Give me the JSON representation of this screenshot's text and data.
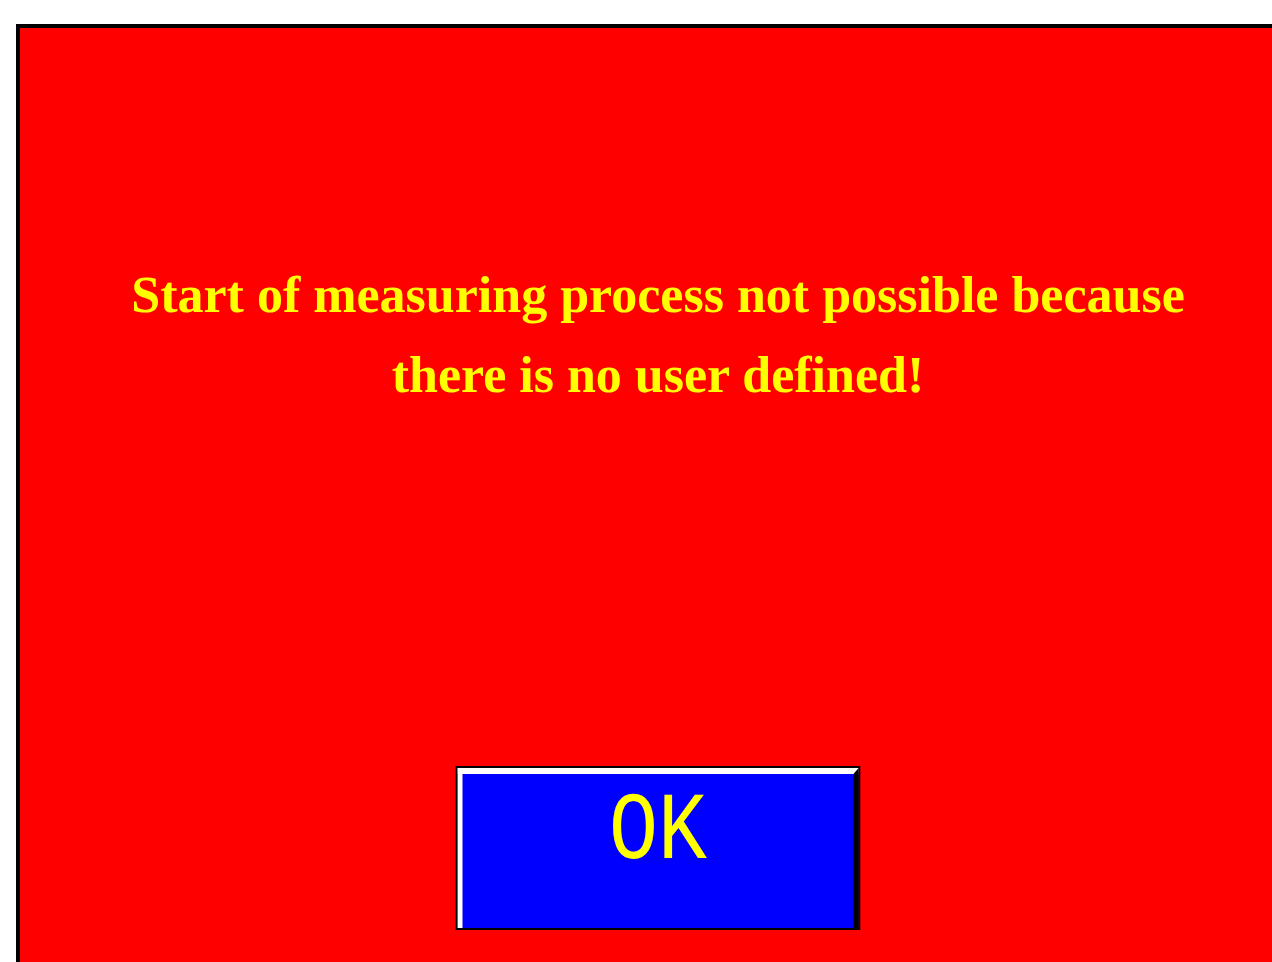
{
  "message": "Start of measuring process not possible because there is no user defined!",
  "buttons": [
    {
      "label": "OK"
    }
  ]
}
